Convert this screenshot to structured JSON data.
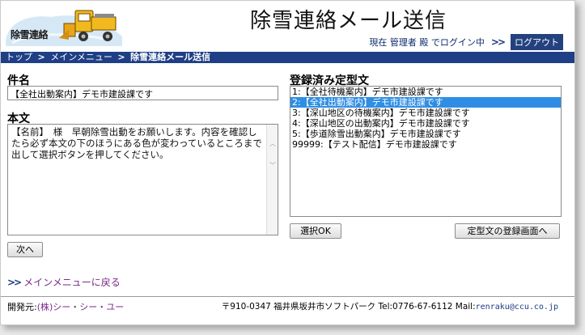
{
  "header": {
    "logo_text": "除雪連絡",
    "page_title": "除雪連絡メール送信",
    "login_status": "現在 管理者 殿 でログイン中",
    "logout_label": "ログアウト"
  },
  "breadcrumb": {
    "items": [
      "トップ",
      "メインメニュー"
    ],
    "current": "除雪連絡メール送信"
  },
  "form": {
    "subject_label": "件名",
    "subject_value": "【全社出動案内】デモ市建設課です",
    "body_label": "本文",
    "body_value": "【名前】　様　早朝除雪出動をお願いします。内容を確認したら必ず本文の下のほうにある色が変わっているところまで出して選択ボタンを押してください。",
    "next_label": "次へ"
  },
  "templates": {
    "label": "登録済み定型文",
    "selected_index": 1,
    "items": [
      "1:【全社待機案内】デモ市建設課です",
      "2:【全社出動案内】デモ市建設課です",
      "3:【深山地区の待機案内】デモ市建設課です",
      "4:【深山地区の出動案内】デモ市建設課です",
      "5:【歩道除雪出動案内】デモ市建設課です",
      "99999:【テスト配信】デモ市建設課です"
    ],
    "select_label": "選択OK",
    "register_label": "定型文の登録画面へ"
  },
  "back_link": "メインメニューに戻る",
  "footer": {
    "dev_prefix": "開発元:",
    "company": "(株)シー・シー・ユー",
    "address": "〒910-0347 福井県坂井市ソフトパーク Tel:0776-67-6112 Mail:",
    "email": "renraku@ccu.co.jp"
  },
  "colors": {
    "nav_bar": "#1e3f85",
    "selection": "#2f8ee4",
    "link": "#7a2a8a"
  },
  "icons": {
    "logo": "snowplow-truck-icon",
    "chevron": "double-chevron-right-icon"
  }
}
